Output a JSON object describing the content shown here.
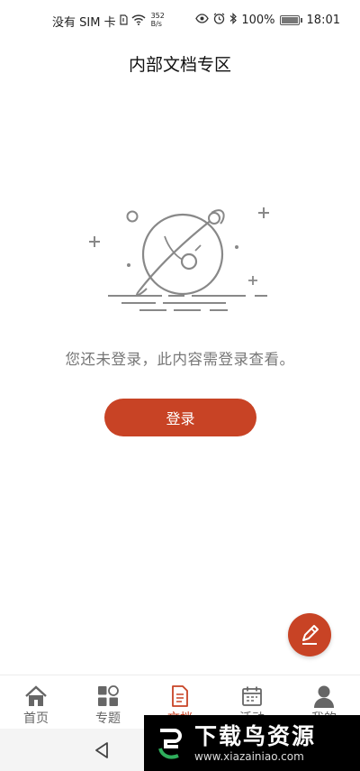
{
  "status_bar": {
    "carrier": "没有 SIM 卡",
    "speed_value": "352",
    "speed_unit": "B/s",
    "battery": "100%",
    "time": "18:01"
  },
  "header": {
    "title": "内部文档专区"
  },
  "empty_state": {
    "message": "您还未登录，此内容需登录查看。",
    "login_label": "登录"
  },
  "tabs": [
    {
      "label": "首页",
      "icon": "home-icon"
    },
    {
      "label": "专题",
      "icon": "grid-icon"
    },
    {
      "label": "文档",
      "icon": "document-icon",
      "active": true
    },
    {
      "label": "活动",
      "icon": "calendar-icon"
    },
    {
      "label": "我的",
      "icon": "person-icon"
    }
  ],
  "watermark": {
    "title": "下载鸟资源",
    "url": "www.xiazainiao.com"
  },
  "colors": {
    "accent": "#c84325"
  }
}
